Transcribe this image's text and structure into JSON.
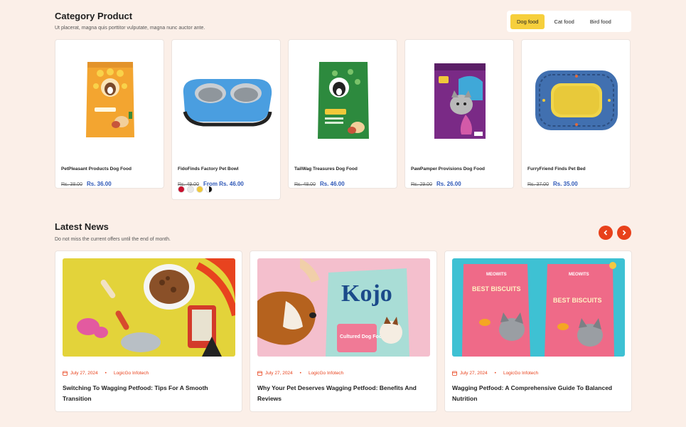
{
  "category": {
    "title": "Category Product",
    "subtitle": "Ut placerat, magna quis porttitor vulputate, magna nunc auctor ante.",
    "tabs": [
      "Dog food",
      "Cat food",
      "Bird food"
    ],
    "active_tab": "Dog food",
    "accent": "#f6cf3c"
  },
  "products": [
    {
      "name": "PetPleasant Products Dog Food",
      "old_price": "Rs. 38.00",
      "new_price": "Rs. 36.00",
      "icon": "dog-food-bag-orange"
    },
    {
      "name": "FidoFinds Factory Pet Bowl",
      "old_price": "Rs. 49.00",
      "new_price": "From Rs. 46.00",
      "icon": "pet-bowl-blue",
      "swatches": [
        "#c8102e",
        "#e8e8e8",
        "#f0c93a",
        "#111111"
      ]
    },
    {
      "name": "TailWag Treasures Dog Food",
      "old_price": "Rs. 48.00",
      "new_price": "Rs. 46.00",
      "icon": "dog-food-bag-green"
    },
    {
      "name": "PawPamper Provisions Dog Food",
      "old_price": "Rs. 29.00",
      "new_price": "Rs. 26.00",
      "icon": "cat-food-bag-purple"
    },
    {
      "name": "FurryFriend Finds Pet Bed",
      "old_price": "Rs. 37.00",
      "new_price": "Rs. 35.00",
      "icon": "pet-bed"
    }
  ],
  "news": {
    "title": "Latest News",
    "subtitle": "Do not miss the current offers until the end of month.",
    "prev_icon": "chevron-left-icon",
    "next_icon": "chevron-right-icon",
    "nav_color": "#e8411b",
    "items": [
      {
        "date": "July 27, 2024",
        "author": "LogicGo Infotech",
        "title": "Switching To Wagging Petfood: Tips For A Smooth Transition"
      },
      {
        "date": "July 27, 2024",
        "author": "LogicGo Infotech",
        "title": "Why Your Pet Deserves Wagging Petfood: Benefits And Reviews"
      },
      {
        "date": "July 27, 2024",
        "author": "LogicGo Infotech",
        "title": "Wagging Petfood: A Comprehensive Guide To Balanced Nutrition"
      }
    ],
    "image_texts": {
      "kojo": "Kojo",
      "kojo_sub": "Cultured Dog Food",
      "meowits": "MEOWITS",
      "biscuits": "BEST BISCUITS"
    }
  }
}
